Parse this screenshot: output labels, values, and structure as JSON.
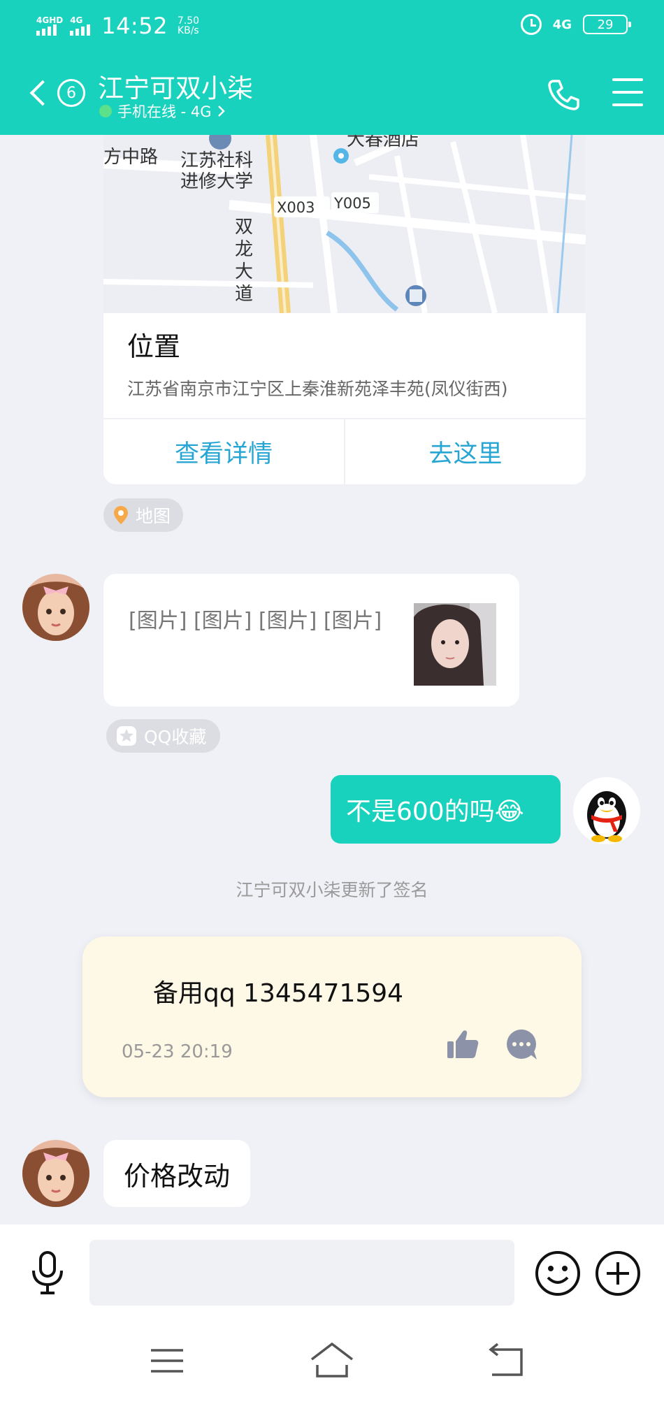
{
  "status_bar": {
    "net1": "4GHD",
    "net2": "4G",
    "time": "14:52",
    "speed_value": "7.50",
    "speed_unit": "KB/s",
    "net_right": "4G",
    "battery": "29"
  },
  "header": {
    "unread_count": "6",
    "title": "江宁可双小柒",
    "subtitle": "手机在线 - 4G"
  },
  "location_card": {
    "map_labels": [
      "大春酒店",
      "江苏社科",
      "进修大学",
      "方中路",
      "X003",
      "Y005",
      "双",
      "龙",
      "大",
      "道"
    ],
    "title": "位置",
    "address": "江苏省南京市江宁区上秦淮新苑泽丰苑(凤仪街西)",
    "view_details": "查看详情",
    "go_here": "去这里"
  },
  "map_tag": "地图",
  "image_message": {
    "text": "[图片] [图片] [图片] [图片]"
  },
  "favorite_tag": "QQ收藏",
  "sent_message": "不是600的吗😂",
  "system_note": "江宁可双小柒更新了签名",
  "signature_card": {
    "text": "备用qq 1345471594",
    "timestamp": "05-23 20:19"
  },
  "last_message": "价格改动",
  "input": {
    "value": "",
    "placeholder": ""
  },
  "colors": {
    "brand": "#19d2bd",
    "link": "#27a6d3",
    "signature_bg": "#fdf9e6"
  }
}
